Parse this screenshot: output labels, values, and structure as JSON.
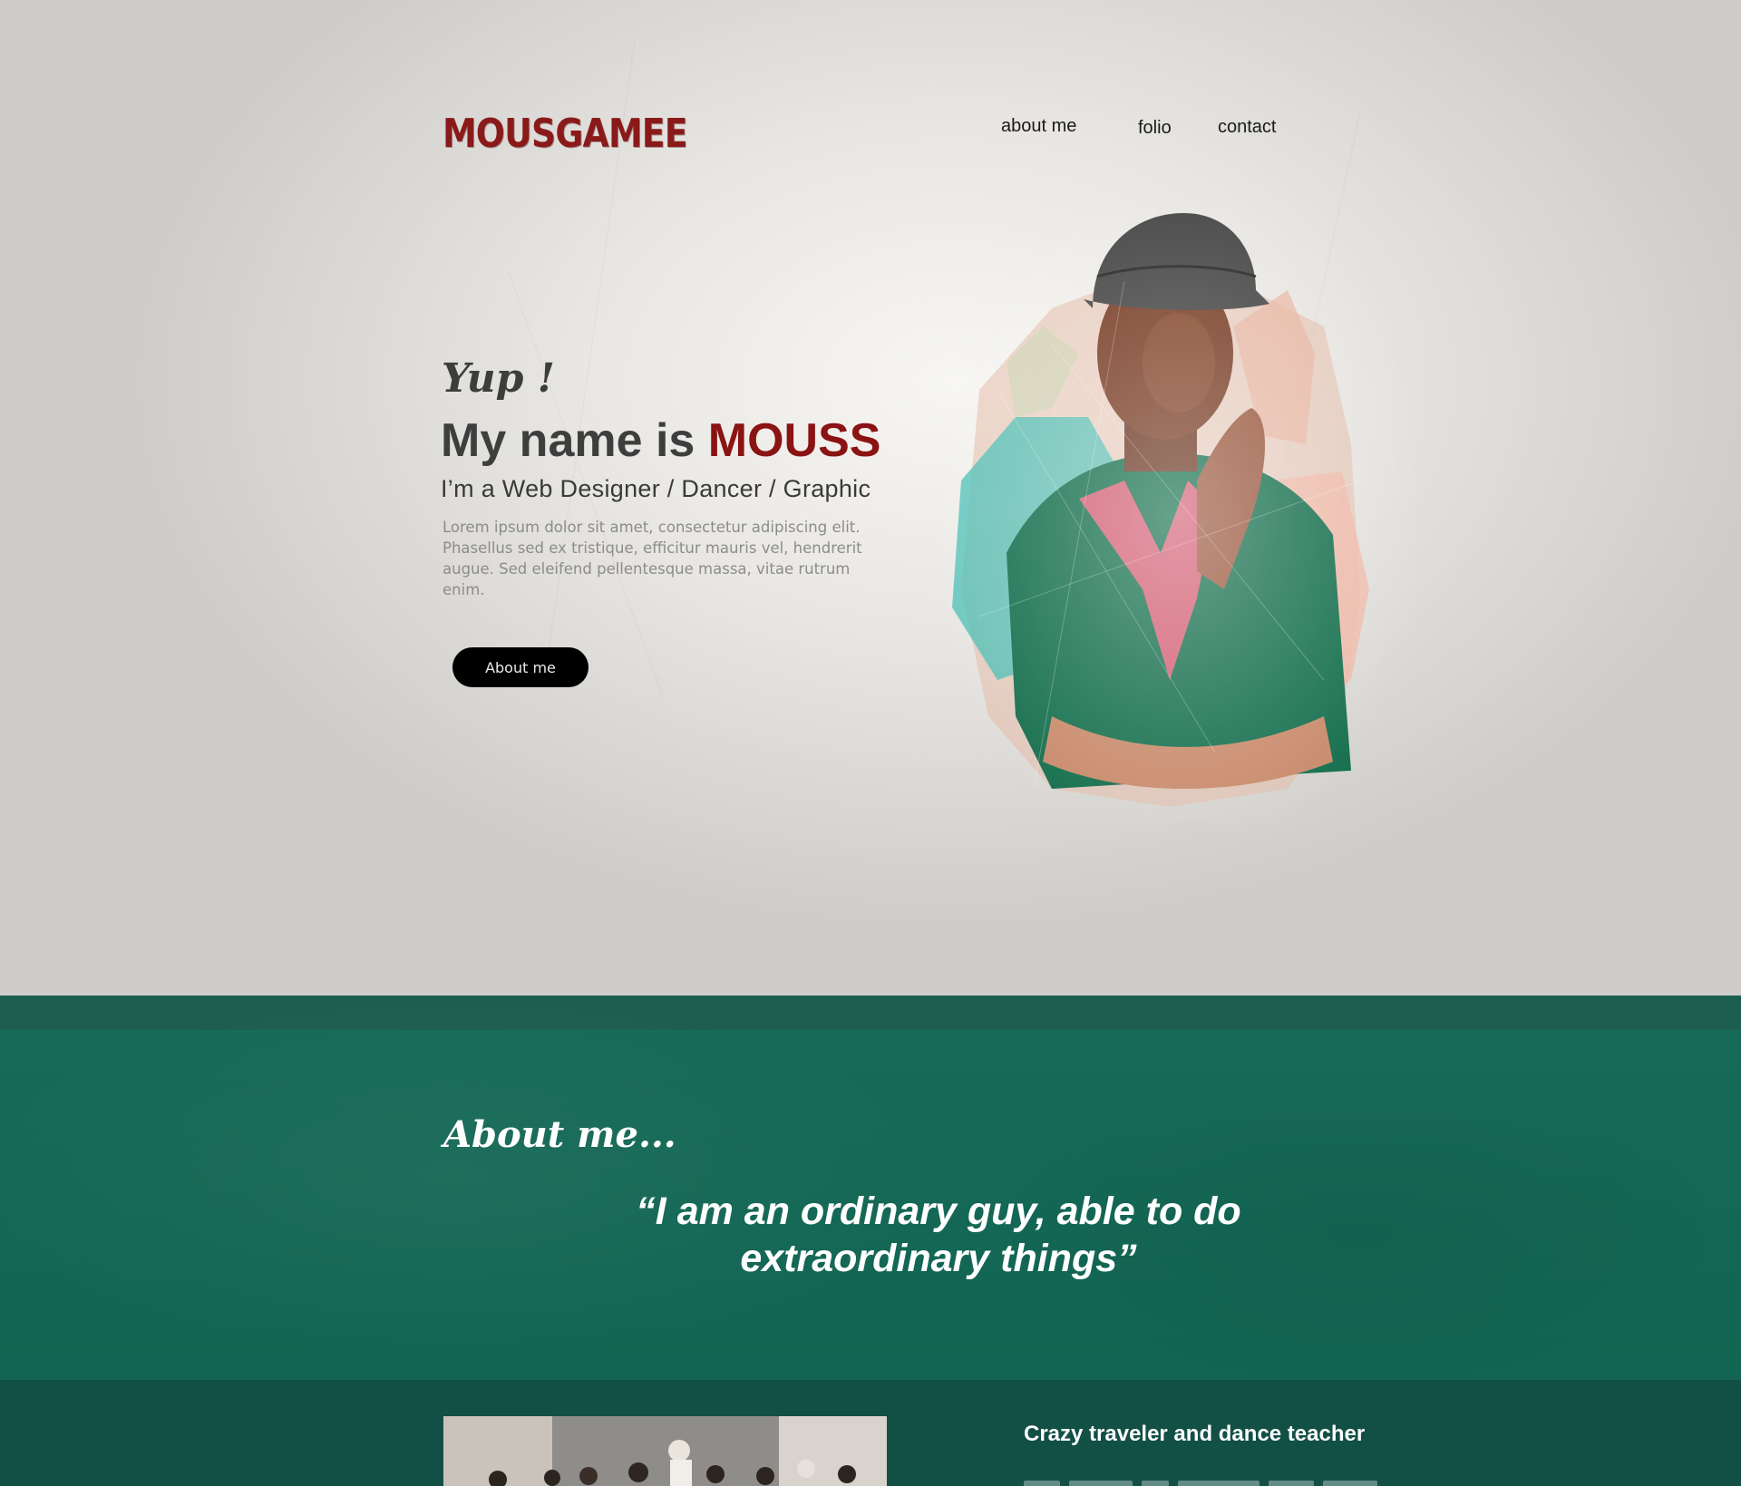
{
  "brand": {
    "logo": "MOUSGAMEE",
    "logo_color": "#8a1a1a"
  },
  "nav": {
    "items": [
      {
        "label": "about me"
      },
      {
        "label": "folio"
      },
      {
        "label": "contact"
      }
    ]
  },
  "hero": {
    "greeting": "Yup !",
    "headline_prefix": "My name is ",
    "headline_name": "MOUSS",
    "subtitle": "I’m a Web Designer / Dancer / Graphic",
    "body": "Lorem ipsum dolor sit amet, consectetur adipiscing elit. Phasellus sed ex tristique, efficitur mauris vel, hendrerit augue. Sed eleifend pellentesque massa, vitae rutrum enim.",
    "button_label": "About me",
    "accent_color": "#8a1313"
  },
  "about": {
    "title": "About me...",
    "quote": "“I am an ordinary guy, able to do extraordinary things”",
    "band_color": "#116552"
  },
  "bottom": {
    "subheading": "Crazy traveler and dance teacher"
  }
}
